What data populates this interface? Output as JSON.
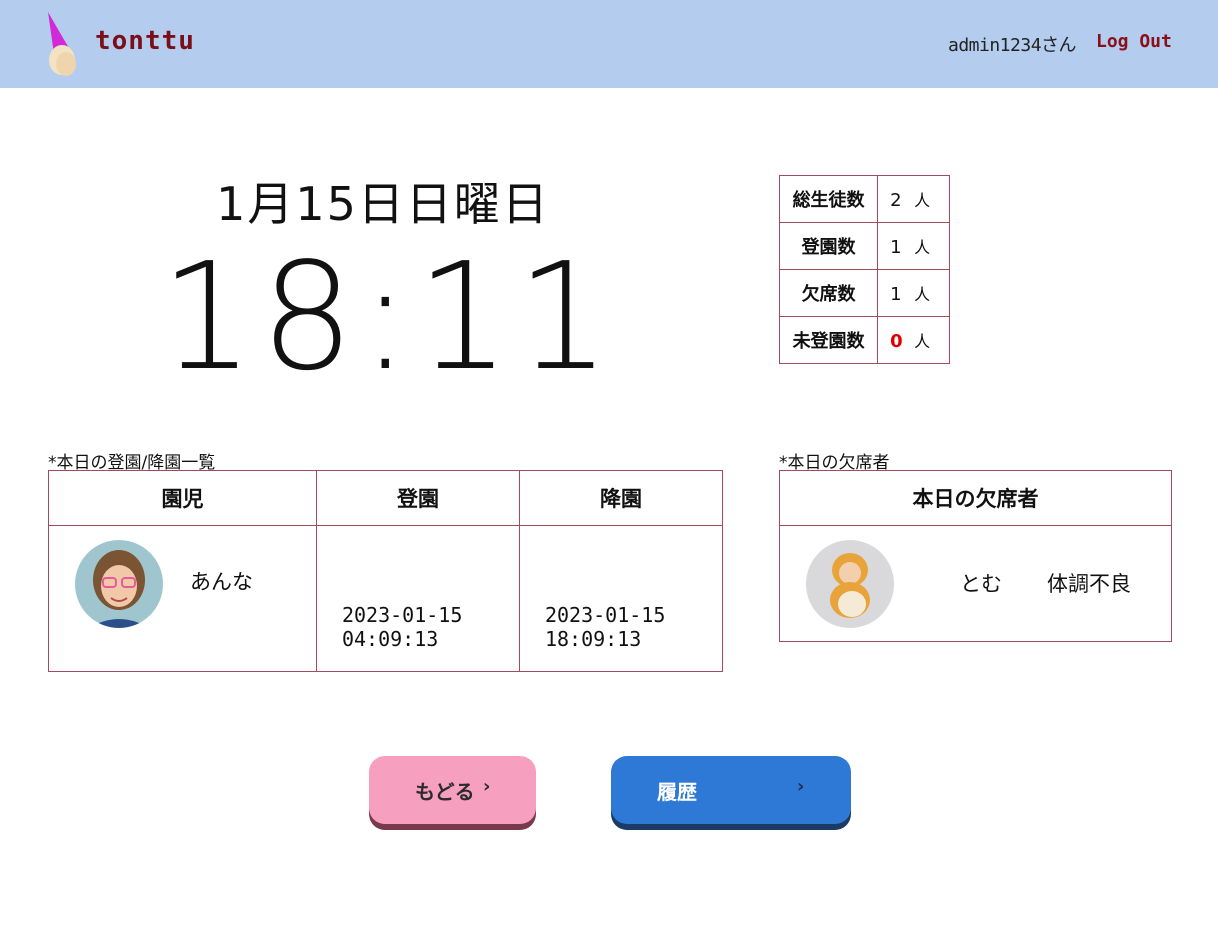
{
  "header": {
    "brand": "tonttu",
    "user": "admin1234さん",
    "logout": "Log Out"
  },
  "clock": {
    "date": "1月15日日曜日",
    "time": "18:11"
  },
  "stats": [
    {
      "label": "総生徒数",
      "value": "2",
      "unit": "人"
    },
    {
      "label": "登園数",
      "value": "1",
      "unit": "人"
    },
    {
      "label": "欠席数",
      "value": "1",
      "unit": "人"
    },
    {
      "label": "未登園数",
      "value": "0",
      "unit": "人",
      "highlight": "#e00000"
    }
  ],
  "attendance": {
    "caption": "*本日の登園/降園一覧",
    "headers": [
      "園児",
      "登園",
      "降園"
    ],
    "rows": [
      {
        "name": "あんな",
        "arrive": "2023-01-15\n04:09:13",
        "leave": "2023-01-15\n18:09:13",
        "arrive_date": "2023-01-15",
        "arrive_time": "04:09:13",
        "leave_date": "2023-01-15",
        "leave_time": "18:09:13"
      }
    ]
  },
  "absent": {
    "caption": "*本日の欠席者",
    "header": "本日の欠席者",
    "rows": [
      {
        "name": "とむ",
        "reason": "体調不良"
      }
    ]
  },
  "buttons": {
    "back": "もどる",
    "history": "履歴"
  },
  "colors": {
    "header_bg": "#b4cdee",
    "brand": "#7a0f1a",
    "table_border": "#a14b5c",
    "back_button": "#f79fbf",
    "history_button": "#2f79d6"
  }
}
